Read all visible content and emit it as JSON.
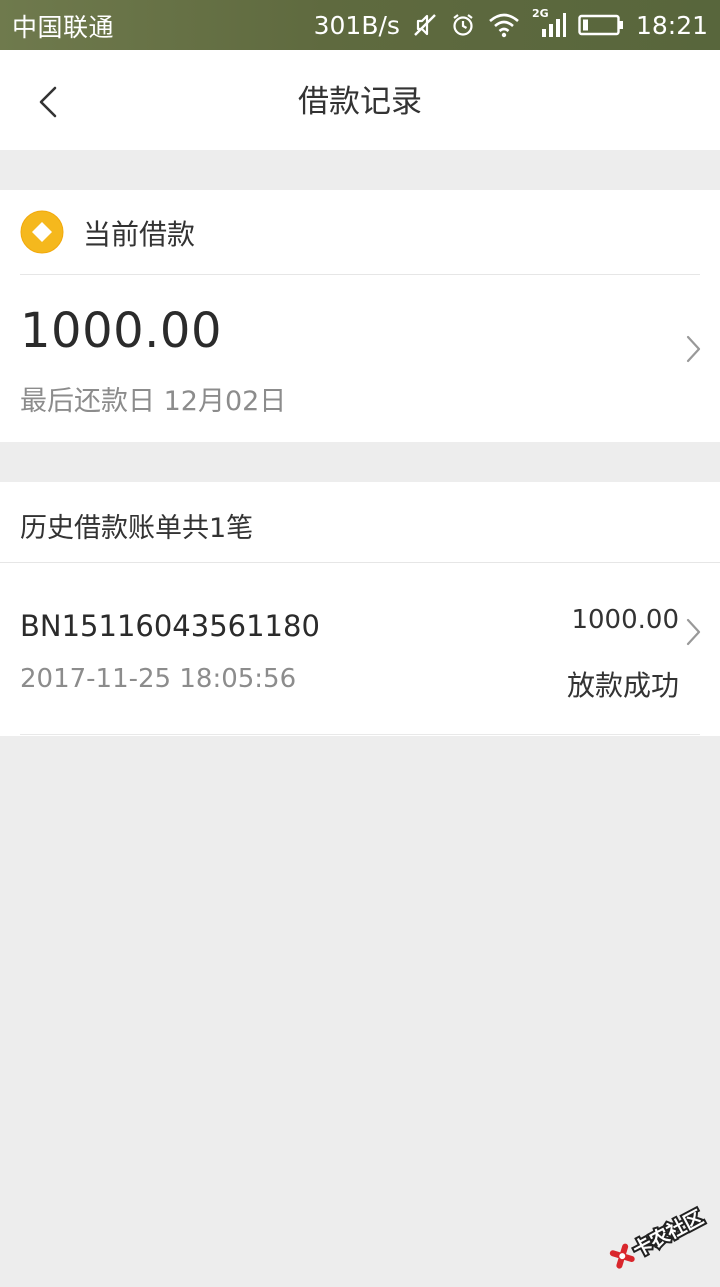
{
  "status_bar": {
    "carrier": "中国联通",
    "speed": "301B/s",
    "network": "2G",
    "time": "18:21"
  },
  "header": {
    "title": "借款记录",
    "back_icon": "chevron-left-icon"
  },
  "current_loan": {
    "label": "当前借款",
    "amount": "1000.00",
    "due_label": "最后还款日 12月02日",
    "icon": "coin-icon",
    "icon_color": "#f5b81d"
  },
  "history": {
    "header": "历史借款账单共1笔",
    "bills": [
      {
        "id": "BN15116043561180",
        "date": "2017-11-25 18:05:56",
        "amount": "1000.00",
        "status": "放款成功"
      }
    ]
  },
  "watermark": {
    "text": "卡农社区"
  },
  "colors": {
    "status_bar": "#636f43",
    "background": "#ededed",
    "card": "#ffffff",
    "primary_text": "#333333",
    "secondary_text": "#8c8c8c",
    "accent": "#f5b81d"
  }
}
